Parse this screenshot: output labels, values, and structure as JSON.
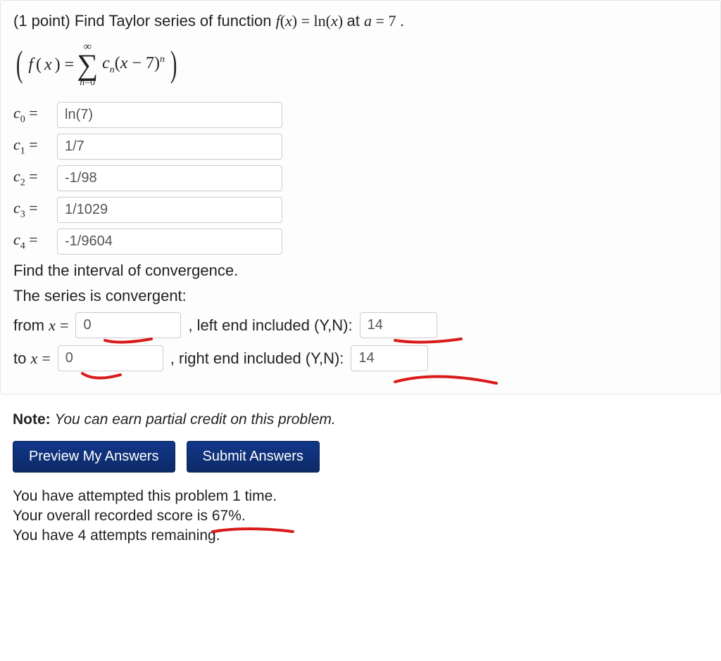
{
  "problem": {
    "points_prefix": "(1 point) ",
    "prompt_text": "Find Taylor series of function ",
    "fx_expr": "f(x) = ln(x)",
    "at_text": " at ",
    "a_expr": "a = 7",
    "period": ".",
    "series_left": "f(x) = ",
    "sigma_top": "∞",
    "sigma_bottom": "n=0",
    "term_expr_cn": "c",
    "term_expr_sub": "n",
    "term_expr_rest": "(x − 7)",
    "term_expr_pow": "n"
  },
  "coeffs": [
    {
      "label_var": "c",
      "label_sub": "0",
      "value": "ln(7)"
    },
    {
      "label_var": "c",
      "label_sub": "1",
      "value": "1/7"
    },
    {
      "label_var": "c",
      "label_sub": "2",
      "value": "-1/98"
    },
    {
      "label_var": "c",
      "label_sub": "3",
      "value": "1/1029"
    },
    {
      "label_var": "c",
      "label_sub": "4",
      "value": "-1/9604"
    }
  ],
  "interval": {
    "find_text": "Find the interval of convergence.",
    "convergent_text": "The series is convergent:",
    "from_label": "from ",
    "x_eq": "x = ",
    "from_value": "0",
    "left_end_label": ", left end included (Y,N): ",
    "left_end_value": "14",
    "to_label": "to ",
    "to_value": "0",
    "right_end_label": ", right end included (Y,N): ",
    "right_end_value": "14"
  },
  "note": {
    "label": "Note:",
    "text": " You can earn partial credit on this problem."
  },
  "buttons": {
    "preview": "Preview My Answers",
    "submit": "Submit Answers"
  },
  "status": {
    "attempts": "You have attempted this problem 1 time.",
    "score": "Your overall recorded score is 67%.",
    "remaining": "You have 4 attempts remaining."
  }
}
